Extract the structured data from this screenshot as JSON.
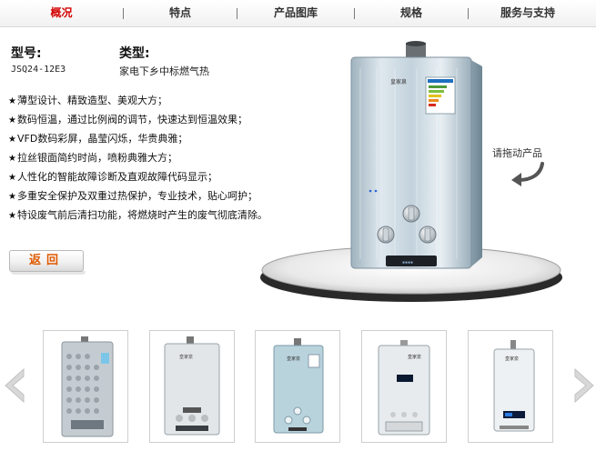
{
  "tabs": [
    {
      "label": "概况",
      "active": true
    },
    {
      "label": "特点",
      "active": false
    },
    {
      "label": "产品图库",
      "active": false
    },
    {
      "label": "规格",
      "active": false
    },
    {
      "label": "服务与支持",
      "active": false
    }
  ],
  "spec": {
    "model_label": "型号:",
    "model_value": "JSQ24-12E3",
    "type_label": "类型:",
    "type_value": "家电下乡中标燃气热"
  },
  "features": [
    "薄型设计、精致造型、美观大方；",
    "数码恒温，通过比例阀的调节，快速达到恒温效果；",
    "VFD数码彩屏，晶莹闪烁，华贵典雅；",
    "拉丝银面简约时尚，喷粉典雅大方；",
    "人性化的智能故障诊断及直观故障代码显示；",
    "多重安全保护及双重过热保护，专业技术，贴心呵护；",
    "特设废气前后清扫功能，将燃烧时产生的废气彻底清除。"
  ],
  "feature_bullet": "★",
  "back_button": "返回",
  "drag_hint": "请拖动产品",
  "product": {
    "brand": "皇家泉"
  },
  "thumbnails_count": 5,
  "colors": {
    "accent": "#d40000",
    "button_text": "#e05a00"
  },
  "icons": {
    "prev": "chevron-left-icon",
    "next": "chevron-right-icon",
    "drag": "rotate-arrow-icon"
  }
}
